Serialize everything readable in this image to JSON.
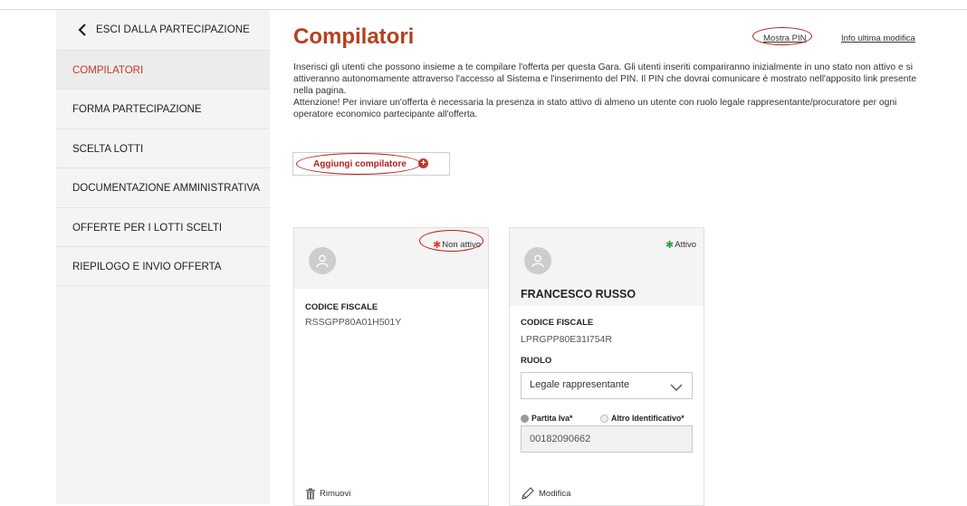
{
  "sidebar": {
    "back_label": "ESCI DALLA PARTECIPAZIONE",
    "items": [
      {
        "label": "COMPILATORI",
        "active": true
      },
      {
        "label": "FORMA PARTECIPAZIONE",
        "active": false
      },
      {
        "label": "SCELTA LOTTI",
        "active": false
      },
      {
        "label": "DOCUMENTAZIONE AMMINISTRATIVA",
        "active": false
      },
      {
        "label": "OFFERTE PER I LOTTI SCELTI",
        "active": false
      },
      {
        "label": "RIEPILOGO E INVIO OFFERTA",
        "active": false
      }
    ]
  },
  "main": {
    "title": "Compilatori",
    "show_pin_link": "Mostra PIN",
    "last_edit_link": "Info ultima modifica",
    "intro_paragraph_1": "Inserisci gli utenti che possono insieme a te compilare l'offerta per questa Gara. Gli utenti inseriti compariranno inizialmente in uno stato non attivo e si attiveranno autonomamente attraverso l'accesso al Sistema e l'inserimento del PIN. Il PIN che dovrai comunicare è mostrato nell'apposito link presente nella pagina.",
    "intro_paragraph_2": "Attenzione! Per inviare un'offerta è necessaria la presenza in stato attivo di almeno un utente con ruolo legale rappresentante/procuratore per ogni operatore economico partecipante all'offerta.",
    "add_button_label": "Aggiungi compilatore",
    "colors": {
      "accent": "#b5401f",
      "inactive": "#e53935",
      "active": "#2e9e3a"
    }
  },
  "cards": [
    {
      "status": "Non attivo",
      "name": "",
      "fiscal_code_label": "CODICE FISCALE",
      "fiscal_code": "RSSGPP80A01H501Y",
      "action_label": "Rimuovi"
    },
    {
      "status": "Attivo",
      "name": "FRANCESCO RUSSO",
      "fiscal_code_label": "CODICE FISCALE",
      "fiscal_code": "LPRGPP80E31I754R",
      "role_label": "RUOLO",
      "role_value": "Legale rappresentante",
      "radio_vat_label": "Partita Iva*",
      "radio_other_label": "Altro Identificativo*",
      "vat_value": "00182090662",
      "action_label": "Modifica"
    }
  ]
}
